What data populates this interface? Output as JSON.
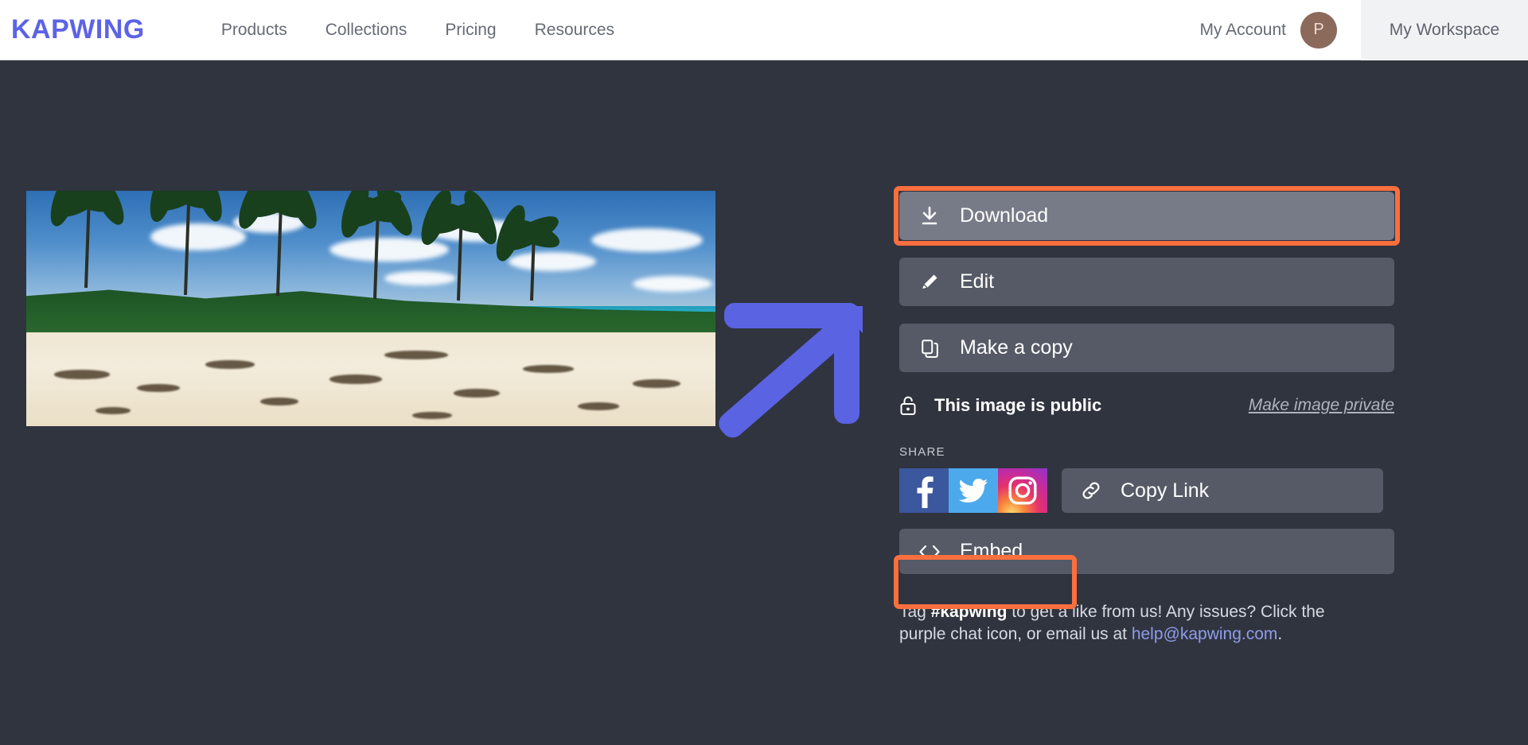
{
  "navbar": {
    "brand": "KAPWING",
    "links": [
      {
        "label": "Products"
      },
      {
        "label": "Collections"
      },
      {
        "label": "Pricing"
      },
      {
        "label": "Resources"
      }
    ],
    "account_label": "My Account",
    "avatar_initial": "P",
    "workspace_label": "My Workspace"
  },
  "preview": {
    "alt": "beach-photo-thumbnail"
  },
  "annotation": {
    "arrow_color": "#5a63e2",
    "highlight_color": "#f96f3e",
    "points_to": "Download"
  },
  "actions": {
    "download": {
      "label": "Download",
      "icon": "download-icon"
    },
    "edit": {
      "label": "Edit",
      "icon": "pencil-icon"
    },
    "copy": {
      "label": "Make a copy",
      "icon": "duplicate-icon"
    }
  },
  "privacy": {
    "status_label": "This image is public",
    "toggle_link": "Make image private",
    "icon": "unlocked-padlock-icon"
  },
  "share": {
    "heading": "SHARE",
    "socials": [
      {
        "name": "facebook",
        "letter": "f"
      },
      {
        "name": "twitter",
        "letter": ""
      },
      {
        "name": "instagram",
        "letter": ""
      }
    ],
    "copy_link_label": "Copy Link",
    "embed_label": "Embed"
  },
  "footer": {
    "text_1": "Tag ",
    "hashtag": "#kapwing",
    "text_2": " to get a like from us! Any issues? Click the purple chat icon, or email us at ",
    "email": "help@kapwing.com",
    "text_3": "."
  },
  "colors": {
    "page_background": "#30343f",
    "button_fill": "#555a66",
    "button_hover_fill": "#767b87",
    "brand_purple": "#5d63e6",
    "accent_orange": "#f96f3e",
    "avatar_brown": "#8b6a5c"
  }
}
